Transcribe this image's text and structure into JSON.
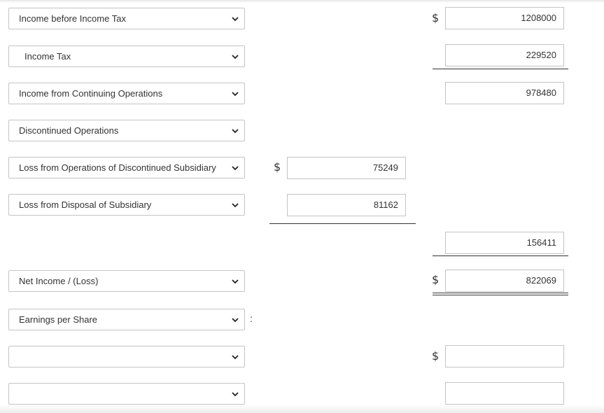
{
  "currency_symbol": "$",
  "colon": ":",
  "rows": {
    "income_before_tax": {
      "label": "Income before Income Tax",
      "value": "1208000"
    },
    "income_tax": {
      "label": "Income Tax",
      "value": "229520"
    },
    "continuing_ops": {
      "label": "Income from Continuing Operations",
      "value": "978480"
    },
    "discontinued_ops": {
      "label": "Discontinued Operations"
    },
    "loss_operations": {
      "label": "Loss from Operations of Discontinued Subsidiary",
      "value": "75249"
    },
    "loss_disposal": {
      "label": "Loss from Disposal of Subsidiary",
      "value": "81162"
    },
    "discontinued_total": {
      "value": "156411"
    },
    "net_income": {
      "label": "Net Income / (Loss)",
      "value": "822069"
    },
    "eps": {
      "label": "Earnings per Share"
    },
    "eps_line1": {
      "label": "",
      "value": ""
    },
    "eps_line2": {
      "label": "",
      "value": ""
    }
  },
  "icons": {
    "dropdown": "chevron-down-icon"
  }
}
